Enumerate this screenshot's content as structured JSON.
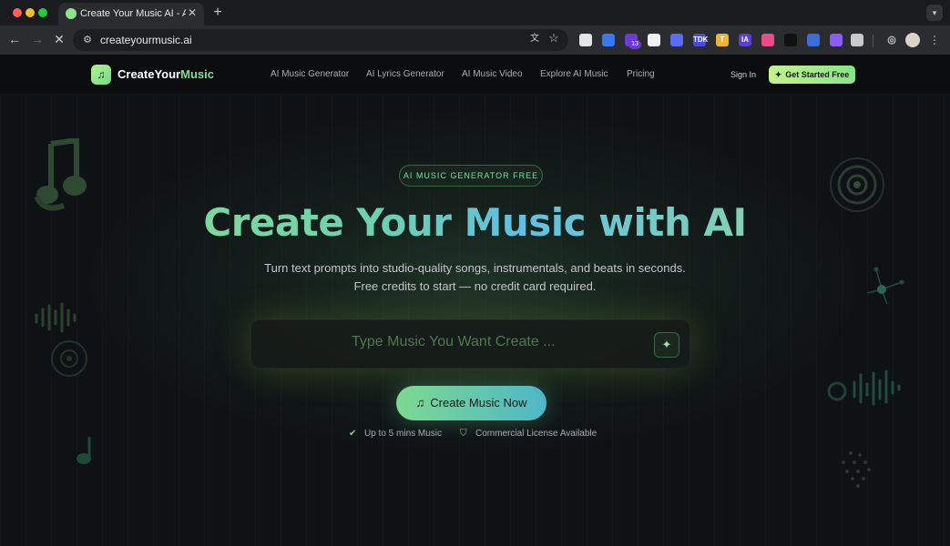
{
  "browser": {
    "tab_title": "Create Your Music AI - AI Musi",
    "url": "createyourmusic.ai",
    "extension_badge": "13",
    "extensions": [
      {
        "name": "clock-ext-icon",
        "label": "",
        "color": "#e5e5e5"
      },
      {
        "name": "shield-ext-icon",
        "label": "",
        "color": "#3a78f2"
      },
      {
        "name": "purple-ext-icon",
        "label": "",
        "color": "#6d3ad6"
      },
      {
        "name": "circle-ext-icon",
        "label": "",
        "color": "#f0f0f0"
      },
      {
        "name": "wave-ext-icon",
        "label": "",
        "color": "#5b6cf0"
      },
      {
        "name": "tdk-ext-icon",
        "label": "TDK",
        "color": "#4b4be0"
      },
      {
        "name": "t-ext-icon",
        "label": "T",
        "color": "#f2b233"
      },
      {
        "name": "ia-ext-icon",
        "label": "IA",
        "color": "#5b3fd0"
      },
      {
        "name": "ring-ext-icon",
        "label": "",
        "color": "#e84c8a"
      },
      {
        "name": "chart-ext-icon",
        "label": "",
        "color": "#111111"
      },
      {
        "name": "tag-ext-icon",
        "label": "",
        "color": "#3a6fd8"
      },
      {
        "name": "gem-ext-icon",
        "label": "",
        "color": "#8a5cf5"
      },
      {
        "name": "puzzle-ext-icon",
        "label": "",
        "color": "#c9c9cc"
      }
    ]
  },
  "site": {
    "logo_prefix": "CreateYour",
    "logo_accent": "Music",
    "nav": [
      "AI Music Generator",
      "AI Lyrics Generator",
      "AI Music Video",
      "Explore AI Music",
      "Pricing"
    ],
    "sign_in": "Sign In",
    "get_started": "Get Started Free"
  },
  "hero": {
    "pill": "AI MUSIC GENERATOR FREE",
    "title": "Create Your Music with AI",
    "subtitle_1": "Turn text prompts into studio-quality songs, instrumentals, and beats in seconds.",
    "subtitle_2": "Free credits to start — no credit card required.",
    "prompt_placeholder": "Type Music You Want Create ...",
    "create_button": "Create Music Now",
    "features": [
      "Up to 5 mins Music",
      "Commercial License Available"
    ]
  },
  "colors": {
    "accent_green": "#7be08f",
    "accent_teal": "#4fb6c8",
    "background": "#0f1214"
  }
}
